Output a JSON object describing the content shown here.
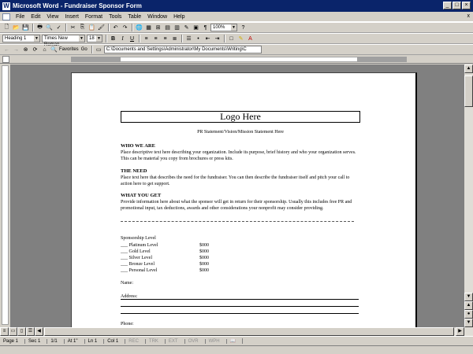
{
  "window": {
    "title": "Microsoft Word - Fundraiser Sponsor Form",
    "app_icon": "W"
  },
  "menu": [
    "File",
    "Edit",
    "View",
    "Insert",
    "Format",
    "Tools",
    "Table",
    "Window",
    "Help"
  ],
  "menu_close": "x",
  "format_bar": {
    "style": "Heading 1",
    "font": "Times New Roman",
    "size": "18",
    "bold": "B",
    "italic": "I",
    "underline": "U",
    "zoom": "100%"
  },
  "web_bar": {
    "favorites": "Favorites",
    "go": "Go",
    "address": "C:\\Documents and Settings\\Administrator\\My Documents\\Writing\\C"
  },
  "doc": {
    "logo": "Logo Here",
    "pr": "PR Statement/Vision/Mission Statement Here",
    "who_h": "WHO WE ARE",
    "who_p": "Place descriptive text here describing your organization. Include its purpose, brief history and who your organization serves. This can be material you copy from brochures or press kits.",
    "need_h": "THE NEED",
    "need_p": "Place text here that describes the need for the fundraiser. You can then describe the fundraiser itself and pitch your call to action here to get support.",
    "get_h": "WHAT YOU GET",
    "get_p": "Provide information here about what the sponsor will get in return for their sponsorship. Usually this includes free PR and promotional input, tax deductions, awards and other considerations your nonprofit may consider providing.",
    "sponsor_title": "Sponsorship Level",
    "levels": [
      {
        "label": "___ Platinum Level",
        "amount": "$000"
      },
      {
        "label": "___ Gold Level",
        "amount": "$000"
      },
      {
        "label": "___ Silver Level",
        "amount": "$000"
      },
      {
        "label": "___ Bronze Level",
        "amount": "$000"
      },
      {
        "label": "___ Personal Level",
        "amount": "$000"
      }
    ],
    "name": "Name:",
    "address": "Address:",
    "phone": "Phone:"
  },
  "status": {
    "page": "Page 1",
    "sec": "Sec 1",
    "pages": "1/1",
    "at": "At 1\"",
    "ln": "Ln 1",
    "col": "Col 1",
    "rec": "REC",
    "trk": "TRK",
    "ext": "EXT",
    "ovr": "OVR",
    "wph": "WPH"
  }
}
